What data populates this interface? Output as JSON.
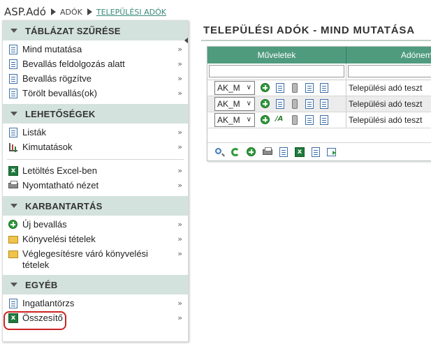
{
  "breadcrumb": {
    "home": "ASP.Adó",
    "level1": "ADÓK",
    "current": "TELEPÜLÉSI ADÓK"
  },
  "page": {
    "title": "TELEPÜLÉSI ADÓK - MIND MUTATÁSA"
  },
  "sidebar": {
    "sections": [
      {
        "title": "TÁBLÁZAT SZŰRÉSE",
        "items": [
          "Mind mutatása",
          "Bevallás feldolgozás alatt",
          "Bevallás rögzítve",
          "Törölt bevallás(ok)"
        ]
      },
      {
        "title": "LEHETŐSÉGEK",
        "items": [
          "Listák",
          "Kimutatások",
          "Letöltés Excel-ben",
          "Nyomtatható nézet"
        ]
      },
      {
        "title": "KARBANTARTÁS",
        "items": [
          "Új bevallás",
          "Könyvelési tételek",
          "Véglegesítésre váró könyvelési tételek"
        ]
      },
      {
        "title": "EGYÉB",
        "items": [
          "Ingatlantörzs",
          "Összesítő"
        ]
      }
    ],
    "arrow": "»"
  },
  "grid": {
    "columns": [
      "Műveletek",
      "Adónem"
    ],
    "rows": [
      {
        "select": "AK_M",
        "adonem": "Települési adó teszt",
        "icons": [
          "add-icon",
          "view-icon",
          "delete-icon",
          "details-icon",
          "document-icon"
        ]
      },
      {
        "select": "AK_M",
        "adonem": "Települési adó teszt",
        "icons": [
          "add-icon",
          "view-icon",
          "delete-icon",
          "details-icon",
          "document-icon"
        ]
      },
      {
        "select": "AK_M",
        "adonem": "Települési adó teszt",
        "icons": [
          "add-icon",
          "spellcheck-icon",
          "delete-icon",
          "details-icon",
          "document-icon"
        ]
      }
    ],
    "toolbar_icons": [
      "search-icon",
      "refresh-icon",
      "add-icon",
      "print-icon",
      "document-icon",
      "excel-icon",
      "settings-icon",
      "export-icon"
    ]
  },
  "colors": {
    "header_green": "#4f9b7e",
    "section_bg": "#d3e2dc",
    "highlight_red": "#cc2222"
  }
}
